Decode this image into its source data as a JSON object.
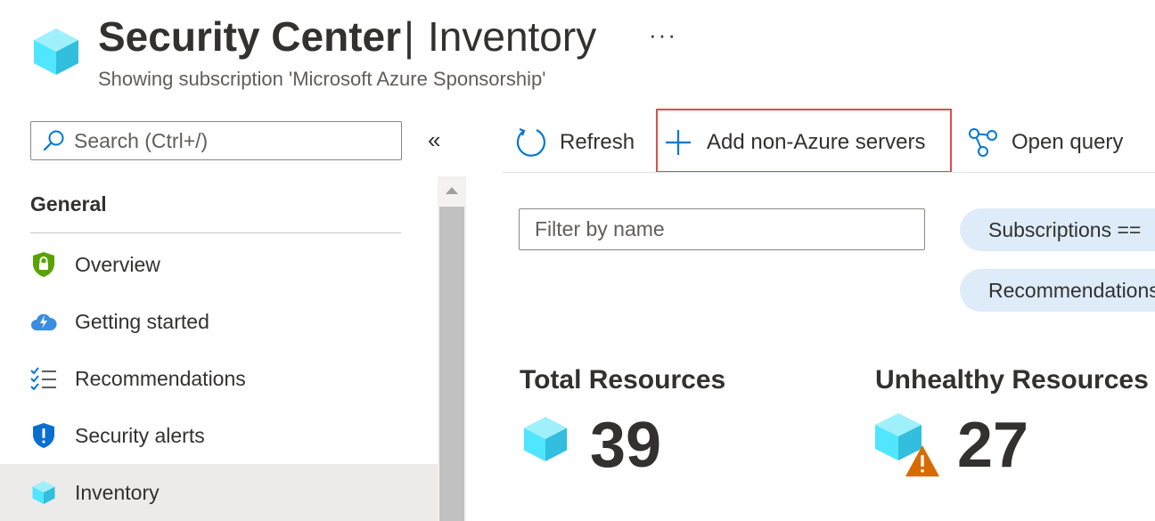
{
  "header": {
    "app_name": "Security Center",
    "separator": "|",
    "page_name": "Inventory",
    "more_label": "···",
    "subtitle": "Showing subscription 'Microsoft Azure Sponsorship'"
  },
  "sidebar": {
    "search_placeholder": "Search (Ctrl+/)",
    "collapse_label": "«",
    "group_label": "General",
    "items": [
      {
        "label": "Overview",
        "icon": "shield-lock-icon"
      },
      {
        "label": "Getting started",
        "icon": "cloud-bolt-icon"
      },
      {
        "label": "Recommendations",
        "icon": "checklist-icon"
      },
      {
        "label": "Security alerts",
        "icon": "shield-alert-icon"
      },
      {
        "label": "Inventory",
        "icon": "cube-icon",
        "active": true
      }
    ]
  },
  "toolbar": {
    "refresh_label": "Refresh",
    "add_label": "Add non-Azure servers",
    "query_label": "Open query"
  },
  "filters": {
    "name_placeholder": "Filter by name",
    "pills": [
      "Subscriptions ==",
      "Recommendations"
    ]
  },
  "stats": {
    "total_title": "Total Resources",
    "total_value": "39",
    "unhealthy_title": "Unhealthy Resources",
    "unhealthy_value": "27"
  },
  "colors": {
    "accent_blue": "#0078d4",
    "highlight_red": "#e04b4b",
    "pill_bg": "#deecf9",
    "active_nav_bg": "#edebe9",
    "warning_orange": "#d86b00"
  }
}
